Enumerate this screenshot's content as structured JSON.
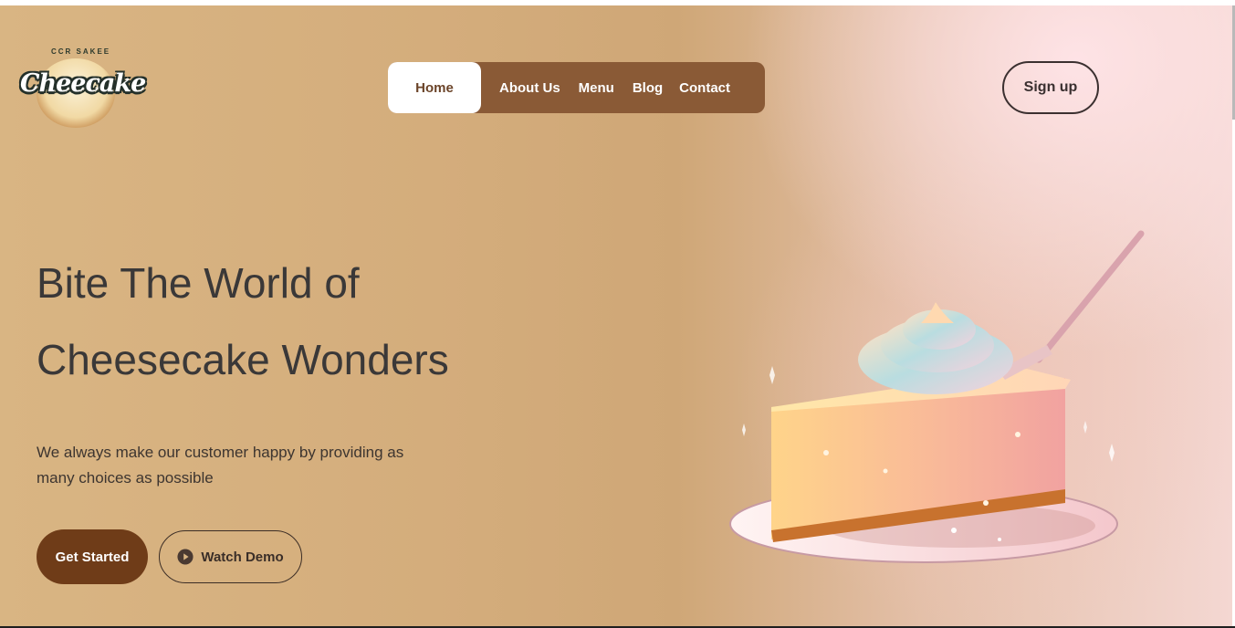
{
  "brand": {
    "logo_arc_text": "CCR SAKEE",
    "logo_word": "Cheecake"
  },
  "nav": {
    "items": [
      {
        "label": "Home",
        "active": true
      },
      {
        "label": "About Us"
      },
      {
        "label": "Menu"
      },
      {
        "label": "Blog"
      },
      {
        "label": "Contact"
      }
    ]
  },
  "header": {
    "signup_label": "Sign up"
  },
  "hero": {
    "headline_line1": "Bite The World of",
    "headline_line2": "Cheesecake Wonders",
    "tagline": "We always make our customer happy by providing as many choices as possible",
    "primary_button": "Get Started",
    "secondary_button": "Watch Demo",
    "secondary_icon": "play-circle-icon"
  },
  "colors": {
    "nav_bg": "#8a5a36",
    "primary_button_bg": "#6f3c18",
    "text_dark": "#3a3838"
  }
}
